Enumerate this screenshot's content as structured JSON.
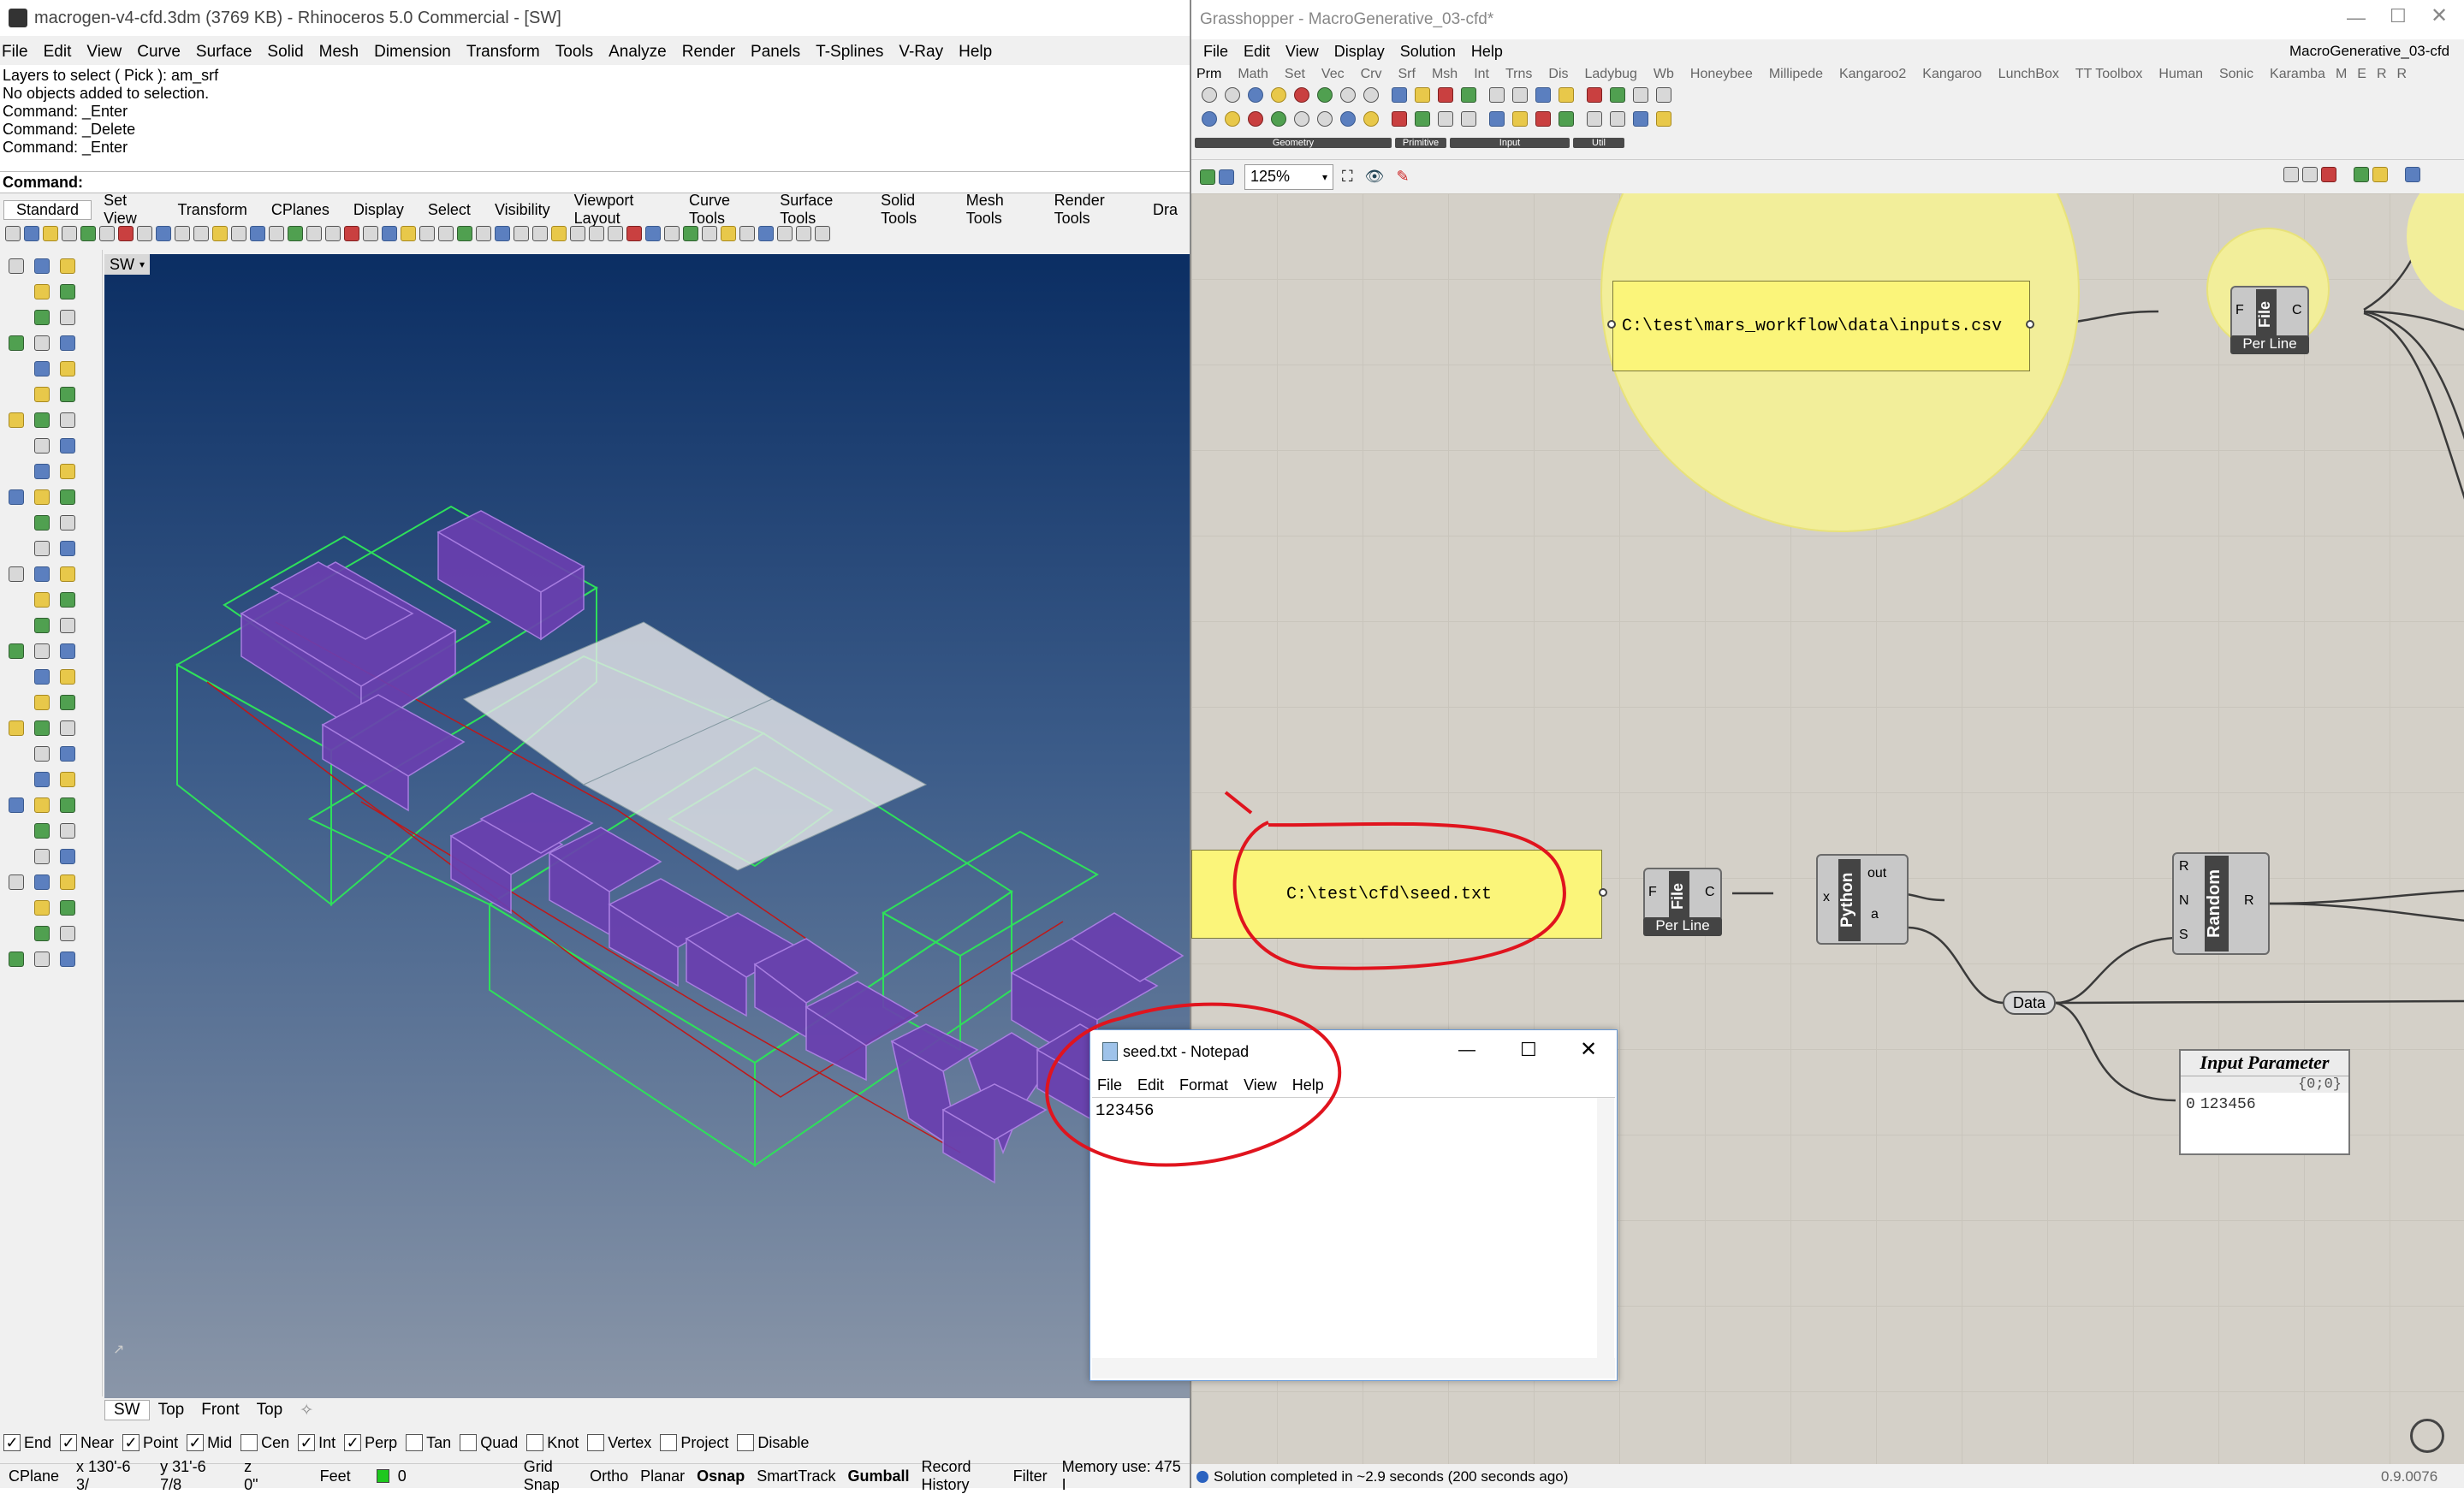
{
  "rhino": {
    "title": "macrogen-v4-cfd.3dm (3769 KB) - Rhinoceros 5.0 Commercial - [SW]",
    "menu": [
      "File",
      "Edit",
      "View",
      "Curve",
      "Surface",
      "Solid",
      "Mesh",
      "Dimension",
      "Transform",
      "Tools",
      "Analyze",
      "Render",
      "Panels",
      "T-Splines",
      "V-Ray",
      "Help"
    ],
    "history": [
      "Layers to select ( Pick ): am_srf",
      "No objects added to selection.",
      "Command: _Enter",
      "Command: _Delete",
      "Command: _Enter"
    ],
    "command_label": "Command:",
    "toolbar_tabs": [
      "Standard",
      "Set View",
      "Transform",
      "CPlanes",
      "Display",
      "Select",
      "Visibility",
      "Viewport Layout",
      "Curve Tools",
      "Surface Tools",
      "Solid Tools",
      "Mesh Tools",
      "Render Tools",
      "Dra"
    ],
    "viewport_label": "SW",
    "viewport_tabs": [
      "SW",
      "Top",
      "Front",
      "Top"
    ],
    "osnap": [
      {
        "label": "End",
        "checked": true
      },
      {
        "label": "Near",
        "checked": true
      },
      {
        "label": "Point",
        "checked": true
      },
      {
        "label": "Mid",
        "checked": true
      },
      {
        "label": "Cen",
        "checked": false
      },
      {
        "label": "Int",
        "checked": true
      },
      {
        "label": "Perp",
        "checked": true
      },
      {
        "label": "Tan",
        "checked": false
      },
      {
        "label": "Quad",
        "checked": false
      },
      {
        "label": "Knot",
        "checked": false
      },
      {
        "label": "Vertex",
        "checked": false
      },
      {
        "label": "Project",
        "checked": false
      },
      {
        "label": "Disable",
        "checked": false
      }
    ],
    "status": {
      "cplane": "CPlane",
      "x": "x 130'-6 3/",
      "y": "y 31'-6 7/8",
      "z": "z 0\"",
      "units": "Feet",
      "layer": "0",
      "toggles": [
        "Grid Snap",
        "Ortho",
        "Planar",
        "Osnap",
        "SmartTrack",
        "Gumball",
        "Record History",
        "Filter"
      ],
      "memory": "Memory use: 475 I"
    }
  },
  "grasshopper": {
    "title": "Grasshopper - MacroGenerative_03-cfd*",
    "doc_name": "MacroGenerative_03-cfd",
    "menu": [
      "File",
      "Edit",
      "View",
      "Display",
      "Solution",
      "Help"
    ],
    "tabs": [
      "Prm",
      "Math",
      "Set",
      "Vec",
      "Crv",
      "Srf",
      "Msh",
      "Int",
      "Trns",
      "Dis",
      "Ladybug",
      "Wb",
      "Honeybee",
      "Millipede",
      "Kangaroo2",
      "Kangaroo",
      "LunchBox",
      "TT Toolbox",
      "Human",
      "Sonic",
      "Karamba",
      "M",
      "E",
      "R",
      "R"
    ],
    "group_labels": [
      "Geometry",
      "Primitive",
      "Input",
      "Util"
    ],
    "zoom": "125%",
    "panel_path1": "C:\\test\\mars_workflow\\data\\inputs.csv",
    "panel_path2": "C:\\test\\cfd\\seed.txt",
    "file_comp": {
      "name": "File",
      "in": "F",
      "out": "C",
      "label": "Per Line"
    },
    "python_comp": {
      "name": "Python",
      "in": "x",
      "out1": "out",
      "out2": "a"
    },
    "random_comp": {
      "name": "Random",
      "in": [
        "R",
        "N",
        "S"
      ],
      "out": "R"
    },
    "data_label": "Data",
    "input_param": {
      "title": "Input Parameter",
      "path": "{0;0}",
      "index": "0",
      "value": "123456"
    },
    "status": "Solution completed in ~2.9 seconds (200 seconds ago)",
    "version": "0.9.0076"
  },
  "notepad": {
    "title": "seed.txt - Notepad",
    "menu": [
      "File",
      "Edit",
      "Format",
      "View",
      "Help"
    ],
    "content": "123456"
  },
  "colors": {
    "viewport_top": "#0b2e63",
    "viewport_bottom": "#8a96a8",
    "gh_canvas": "#d4d0c8",
    "panel_yellow": "#fbf57a",
    "group_yellow": "#f2ee9a",
    "annotation_red": "#e0141e"
  }
}
